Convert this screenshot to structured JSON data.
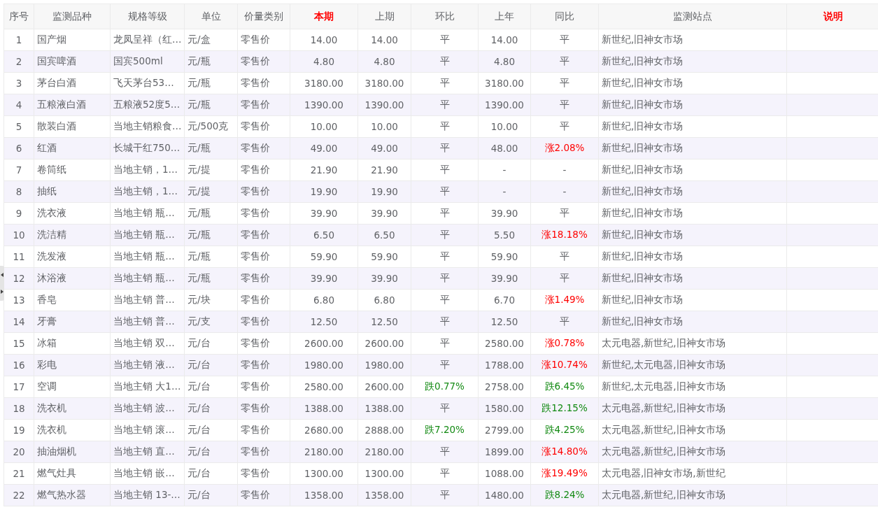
{
  "table": {
    "columns": [
      {
        "label": "序号",
        "highlight": false
      },
      {
        "label": "监测品种",
        "highlight": false
      },
      {
        "label": "规格等级",
        "highlight": false
      },
      {
        "label": "单位",
        "highlight": false
      },
      {
        "label": "价量类别",
        "highlight": false
      },
      {
        "label": "本期",
        "highlight": true
      },
      {
        "label": "上期",
        "highlight": false
      },
      {
        "label": "环比",
        "highlight": false
      },
      {
        "label": "上年",
        "highlight": false
      },
      {
        "label": "同比",
        "highlight": false
      },
      {
        "label": "监测站点",
        "highlight": false
      },
      {
        "label": "说明",
        "highlight": true
      }
    ],
    "rows": [
      {
        "no": "1",
        "item": "国产烟",
        "spec": "龙凤呈祥（红…",
        "unit": "元/盒",
        "price_type": "零售价",
        "current": "14.00",
        "previous": "14.00",
        "mom": {
          "text": "平",
          "rise": false,
          "fall": false
        },
        "last_year": "14.00",
        "yoy": {
          "text": "平",
          "rise": false,
          "fall": false
        },
        "stations": "新世纪,旧神女市场"
      },
      {
        "no": "2",
        "item": "国宾啤酒",
        "spec": "国宾500ml",
        "unit": "元/瓶",
        "price_type": "零售价",
        "current": "4.80",
        "previous": "4.80",
        "mom": {
          "text": "平",
          "rise": false,
          "fall": false
        },
        "last_year": "4.80",
        "yoy": {
          "text": "平",
          "rise": false,
          "fall": false
        },
        "stations": "新世纪,旧神女市场"
      },
      {
        "no": "3",
        "item": "茅台白酒",
        "spec": "飞天茅台53…",
        "unit": "元/瓶",
        "price_type": "零售价",
        "current": "3180.00",
        "previous": "3180.00",
        "mom": {
          "text": "平",
          "rise": false,
          "fall": false
        },
        "last_year": "3180.00",
        "yoy": {
          "text": "平",
          "rise": false,
          "fall": false
        },
        "stations": "新世纪,旧神女市场"
      },
      {
        "no": "4",
        "item": "五粮液白酒",
        "spec": "五粮液52度5…",
        "unit": "元/瓶",
        "price_type": "零售价",
        "current": "1390.00",
        "previous": "1390.00",
        "mom": {
          "text": "平",
          "rise": false,
          "fall": false
        },
        "last_year": "1390.00",
        "yoy": {
          "text": "平",
          "rise": false,
          "fall": false
        },
        "stations": "新世纪,旧神女市场"
      },
      {
        "no": "5",
        "item": "散装白酒",
        "spec": "当地主销粮食…",
        "unit": "元/500克",
        "price_type": "零售价",
        "current": "10.00",
        "previous": "10.00",
        "mom": {
          "text": "平",
          "rise": false,
          "fall": false
        },
        "last_year": "10.00",
        "yoy": {
          "text": "平",
          "rise": false,
          "fall": false
        },
        "stations": "新世纪,旧神女市场"
      },
      {
        "no": "6",
        "item": "红酒",
        "spec": "长城干红750…",
        "unit": "元/瓶",
        "price_type": "零售价",
        "current": "49.00",
        "previous": "49.00",
        "mom": {
          "text": "平",
          "rise": false,
          "fall": false
        },
        "last_year": "48.00",
        "yoy": {
          "text": "涨2.08%",
          "rise": true,
          "fall": false
        },
        "stations": "新世纪,旧神女市场"
      },
      {
        "no": "7",
        "item": "卷筒纸",
        "spec": "当地主销，1…",
        "unit": "元/提",
        "price_type": "零售价",
        "current": "21.90",
        "previous": "21.90",
        "mom": {
          "text": "平",
          "rise": false,
          "fall": false
        },
        "last_year": "-",
        "yoy": {
          "text": "-",
          "rise": false,
          "fall": false
        },
        "stations": "新世纪,旧神女市场"
      },
      {
        "no": "8",
        "item": "抽纸",
        "spec": "当地主销，1…",
        "unit": "元/提",
        "price_type": "零售价",
        "current": "19.90",
        "previous": "19.90",
        "mom": {
          "text": "平",
          "rise": false,
          "fall": false
        },
        "last_year": "-",
        "yoy": {
          "text": "-",
          "rise": false,
          "fall": false
        },
        "stations": "新世纪,旧神女市场"
      },
      {
        "no": "9",
        "item": "洗衣液",
        "spec": "当地主销 瓶…",
        "unit": "元/瓶",
        "price_type": "零售价",
        "current": "39.90",
        "previous": "39.90",
        "mom": {
          "text": "平",
          "rise": false,
          "fall": false
        },
        "last_year": "39.90",
        "yoy": {
          "text": "平",
          "rise": false,
          "fall": false
        },
        "stations": "新世纪,旧神女市场"
      },
      {
        "no": "10",
        "item": "洗洁精",
        "spec": "当地主销 瓶…",
        "unit": "元/瓶",
        "price_type": "零售价",
        "current": "6.50",
        "previous": "6.50",
        "mom": {
          "text": "平",
          "rise": false,
          "fall": false
        },
        "last_year": "5.50",
        "yoy": {
          "text": "涨18.18%",
          "rise": true,
          "fall": false
        },
        "stations": "新世纪,旧神女市场"
      },
      {
        "no": "11",
        "item": "洗发液",
        "spec": "当地主销 瓶…",
        "unit": "元/瓶",
        "price_type": "零售价",
        "current": "59.90",
        "previous": "59.90",
        "mom": {
          "text": "平",
          "rise": false,
          "fall": false
        },
        "last_year": "59.90",
        "yoy": {
          "text": "平",
          "rise": false,
          "fall": false
        },
        "stations": "新世纪,旧神女市场"
      },
      {
        "no": "12",
        "item": "沐浴液",
        "spec": "当地主销 瓶…",
        "unit": "元/瓶",
        "price_type": "零售价",
        "current": "39.90",
        "previous": "39.90",
        "mom": {
          "text": "平",
          "rise": false,
          "fall": false
        },
        "last_year": "39.90",
        "yoy": {
          "text": "平",
          "rise": false,
          "fall": false
        },
        "stations": "新世纪,旧神女市场"
      },
      {
        "no": "13",
        "item": "香皂",
        "spec": "当地主销 普…",
        "unit": "元/块",
        "price_type": "零售价",
        "current": "6.80",
        "previous": "6.80",
        "mom": {
          "text": "平",
          "rise": false,
          "fall": false
        },
        "last_year": "6.70",
        "yoy": {
          "text": "涨1.49%",
          "rise": true,
          "fall": false
        },
        "stations": "新世纪,旧神女市场"
      },
      {
        "no": "14",
        "item": "牙膏",
        "spec": "当地主销 普…",
        "unit": "元/支",
        "price_type": "零售价",
        "current": "12.50",
        "previous": "12.50",
        "mom": {
          "text": "平",
          "rise": false,
          "fall": false
        },
        "last_year": "12.50",
        "yoy": {
          "text": "平",
          "rise": false,
          "fall": false
        },
        "stations": "新世纪,旧神女市场"
      },
      {
        "no": "15",
        "item": "冰箱",
        "spec": "当地主销 双…",
        "unit": "元/台",
        "price_type": "零售价",
        "current": "2600.00",
        "previous": "2600.00",
        "mom": {
          "text": "平",
          "rise": false,
          "fall": false
        },
        "last_year": "2580.00",
        "yoy": {
          "text": "涨0.78%",
          "rise": true,
          "fall": false
        },
        "stations": "太元电器,新世纪,旧神女市场"
      },
      {
        "no": "16",
        "item": "彩电",
        "spec": "当地主销 液…",
        "unit": "元/台",
        "price_type": "零售价",
        "current": "1980.00",
        "previous": "1980.00",
        "mom": {
          "text": "平",
          "rise": false,
          "fall": false
        },
        "last_year": "1788.00",
        "yoy": {
          "text": "涨10.74%",
          "rise": true,
          "fall": false
        },
        "stations": "新世纪,太元电器,旧神女市场"
      },
      {
        "no": "17",
        "item": "空调",
        "spec": "当地主销 大1…",
        "unit": "元/台",
        "price_type": "零售价",
        "current": "2580.00",
        "previous": "2600.00",
        "mom": {
          "text": "跌0.77%",
          "rise": false,
          "fall": true
        },
        "last_year": "2758.00",
        "yoy": {
          "text": "跌6.45%",
          "rise": false,
          "fall": true
        },
        "stations": "新世纪,太元电器,旧神女市场"
      },
      {
        "no": "18",
        "item": "洗衣机",
        "spec": "当地主销 波…",
        "unit": "元/台",
        "price_type": "零售价",
        "current": "1388.00",
        "previous": "1388.00",
        "mom": {
          "text": "平",
          "rise": false,
          "fall": false
        },
        "last_year": "1580.00",
        "yoy": {
          "text": "跌12.15%",
          "rise": false,
          "fall": true
        },
        "stations": "太元电器,新世纪,旧神女市场"
      },
      {
        "no": "19",
        "item": "洗衣机",
        "spec": "当地主销 滚…",
        "unit": "元/台",
        "price_type": "零售价",
        "current": "2680.00",
        "previous": "2888.00",
        "mom": {
          "text": "跌7.20%",
          "rise": false,
          "fall": true
        },
        "last_year": "2799.00",
        "yoy": {
          "text": "跌4.25%",
          "rise": false,
          "fall": true
        },
        "stations": "太元电器,新世纪,旧神女市场"
      },
      {
        "no": "20",
        "item": "抽油烟机",
        "spec": "当地主销 直…",
        "unit": "元/台",
        "price_type": "零售价",
        "current": "2180.00",
        "previous": "2180.00",
        "mom": {
          "text": "平",
          "rise": false,
          "fall": false
        },
        "last_year": "1899.00",
        "yoy": {
          "text": "涨14.80%",
          "rise": true,
          "fall": false
        },
        "stations": "太元电器,新世纪,旧神女市场"
      },
      {
        "no": "21",
        "item": "燃气灶具",
        "spec": "当地主销 嵌…",
        "unit": "元/台",
        "price_type": "零售价",
        "current": "1300.00",
        "previous": "1300.00",
        "mom": {
          "text": "平",
          "rise": false,
          "fall": false
        },
        "last_year": "1088.00",
        "yoy": {
          "text": "涨19.49%",
          "rise": true,
          "fall": false
        },
        "stations": "太元电器,旧神女市场,新世纪"
      },
      {
        "no": "22",
        "item": "燃气热水器",
        "spec": "当地主销 13-…",
        "unit": "元/台",
        "price_type": "零售价",
        "current": "1358.00",
        "previous": "1358.00",
        "mom": {
          "text": "平",
          "rise": false,
          "fall": false
        },
        "last_year": "1480.00",
        "yoy": {
          "text": "跌8.24%",
          "rise": false,
          "fall": true
        },
        "stations": "太元电器,新世纪,旧神女市场"
      }
    ]
  }
}
